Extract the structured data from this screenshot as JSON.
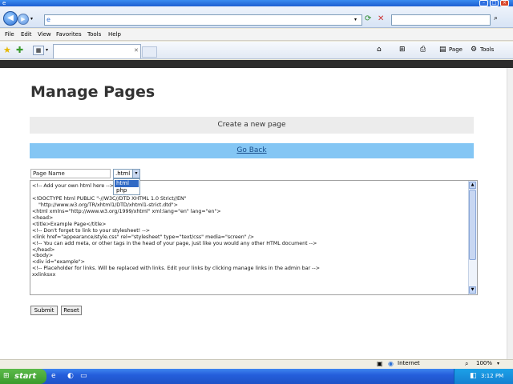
{
  "browser": {
    "menu": [
      "File",
      "Edit",
      "View",
      "Favorites",
      "Tools",
      "Help"
    ],
    "toolbar": {
      "page_label": "Page",
      "tools_label": "Tools"
    },
    "status": {
      "zone": "Internet",
      "zoom": "100%"
    }
  },
  "page": {
    "title": "Manage Pages",
    "create_label": "Create a new page",
    "go_back_label": "Go Back",
    "page_name_value": "Page Name",
    "extension": {
      "selected": ".html",
      "options": [
        "html",
        "php"
      ]
    },
    "editor_lines": [
      "<!-- Add your own html here -->",
      "",
      "<!DOCTYPE html PUBLIC \"-//W3C//DTD XHTML 1.0 Strict//EN\"",
      "    \"http://www.w3.org/TR/xhtml1/DTD/xhtml1-strict.dtd\">",
      "<html xmlns=\"http://www.w3.org/1999/xhtml\" xml:lang=\"en\" lang=\"en\">",
      "<head>",
      "<title>Example Page</title>",
      "<!-- Don't forget to link to your stylesheet! -->",
      "<link href=\"appearance/style.css\" rel=\"stylesheet\" type=\"text/css\" media=\"screen\" />",
      "<!-- You can add meta, or other tags in the head of your page, just like you would any other HTML document -->",
      "</head>",
      "<body>",
      "<div id=\"example\">",
      "<!-- Placeholder for links. Will be replaced with links. Edit your links by clicking manage links in the admin bar -->",
      "xxlinksxx"
    ],
    "submit_label": "Submit",
    "reset_label": "Reset"
  },
  "taskbar": {
    "start_label": "start",
    "clock": "3:12 PM"
  }
}
